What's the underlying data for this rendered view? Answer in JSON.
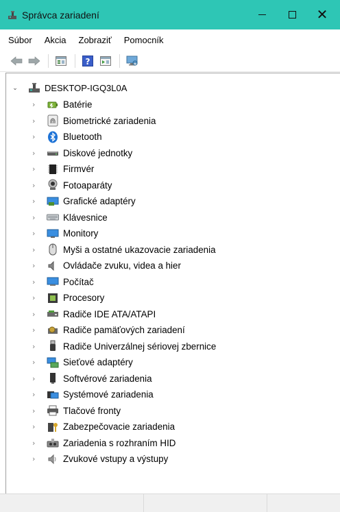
{
  "window": {
    "title": "Správca zariadení",
    "titlebar_color": "#2ec6b5",
    "controls": {
      "minimize_icon": "minimize-icon",
      "maximize_icon": "maximize-icon",
      "close_glyph": "✕"
    }
  },
  "menu": [
    "Súbor",
    "Akcia",
    "Zobraziť",
    "Pomocník"
  ],
  "toolbar": {
    "buttons": [
      "back-arrow-icon",
      "forward-arrow-icon",
      "properties-icon",
      "help-icon",
      "view-icon",
      "monitor-scan-icon"
    ]
  },
  "tree": {
    "root_label": "DESKTOP-IGQ3L0A",
    "expand_glyph": "⌄",
    "collapse_glyph": "›",
    "items": [
      {
        "label": "Batérie",
        "icon": "battery-icon"
      },
      {
        "label": "Biometrické zariadenia",
        "icon": "fingerprint-icon"
      },
      {
        "label": "Bluetooth",
        "icon": "bluetooth-icon"
      },
      {
        "label": "Diskové jednotky",
        "icon": "disk-drive-icon"
      },
      {
        "label": "Firmvér",
        "icon": "firmware-icon"
      },
      {
        "label": "Fotoaparáty",
        "icon": "camera-icon"
      },
      {
        "label": "Grafické adaptéry",
        "icon": "display-adapter-icon"
      },
      {
        "label": "Klávesnice",
        "icon": "keyboard-icon"
      },
      {
        "label": "Monitory",
        "icon": "monitor-icon"
      },
      {
        "label": "Myši a ostatné ukazovacie zariadenia",
        "icon": "mouse-icon"
      },
      {
        "label": "Ovládače zvuku, videa a hier",
        "icon": "speaker-icon"
      },
      {
        "label": "Počítač",
        "icon": "computer-icon"
      },
      {
        "label": "Procesory",
        "icon": "processor-icon"
      },
      {
        "label": "Radiče IDE ATA/ATAPI",
        "icon": "ide-controller-icon"
      },
      {
        "label": "Radiče pamäťových zariadení",
        "icon": "storage-controller-icon"
      },
      {
        "label": "Radiče Univerzálnej sériovej zbernice",
        "icon": "usb-icon"
      },
      {
        "label": "Sieťové adaptéry",
        "icon": "network-adapter-icon"
      },
      {
        "label": "Softvérové zariadenia",
        "icon": "software-device-icon"
      },
      {
        "label": "Systémové zariadenia",
        "icon": "system-device-icon"
      },
      {
        "label": "Tlačové fronty",
        "icon": "printer-icon"
      },
      {
        "label": "Zabezpečovacie zariadenia",
        "icon": "security-device-icon"
      },
      {
        "label": "Zariadenia s rozhraním HID",
        "icon": "hid-icon"
      },
      {
        "label": "Zvukové vstupy a výstupy",
        "icon": "audio-io-icon"
      }
    ]
  }
}
